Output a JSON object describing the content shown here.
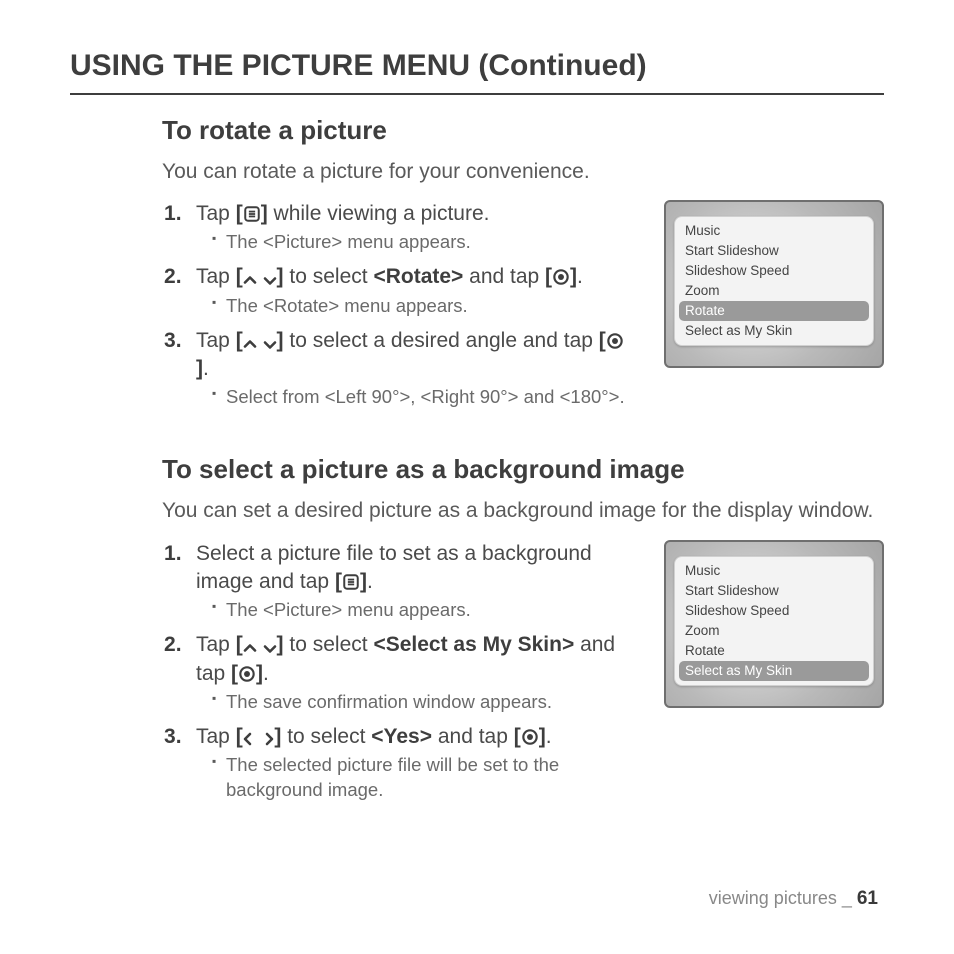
{
  "page_title": "USING THE PICTURE MENU (Continued)",
  "sections": {
    "rotate": {
      "heading": "To rotate a picture",
      "intro": "You can rotate a picture for your convenience.",
      "steps": [
        {
          "pre": "Tap ",
          "icon": "menu",
          "post": " while viewing a picture.",
          "sub": [
            "The <Picture> menu appears."
          ]
        },
        {
          "pre": "Tap ",
          "icon": "updown",
          "mid": " to select ",
          "bold": "<Rotate>",
          "mid2": " and tap ",
          "icon2": "target",
          "post": ".",
          "sub": [
            "The <Rotate> menu appears."
          ]
        },
        {
          "pre": "Tap ",
          "icon": "updown",
          "mid": " to select a desired angle and tap ",
          "icon2": "target",
          "post": ".",
          "sub": [
            "Select from <Left 90°>, <Right 90°> and <180°>."
          ]
        }
      ],
      "menu_selected": "Rotate"
    },
    "skin": {
      "heading": "To select a picture as a background image",
      "intro": "You can set a desired picture as a background image for the display window.",
      "steps": [
        {
          "pre": "Select a picture file to set as a background image and tap ",
          "icon": "menu",
          "post": ".",
          "sub": [
            "The <Picture> menu appears."
          ]
        },
        {
          "pre": "Tap ",
          "icon": "updown",
          "mid": " to select ",
          "bold": "<Select as My Skin>",
          "mid2": " and tap ",
          "icon2": "target",
          "post": ".",
          "sub": [
            "The save confirmation window appears."
          ]
        },
        {
          "pre": "Tap ",
          "icon": "leftright",
          "mid": " to select ",
          "bold": "<Yes>",
          "mid2": " and tap ",
          "icon2": "target",
          "post": ".",
          "sub": [
            "The selected picture file will be set to the background image."
          ]
        }
      ],
      "menu_selected": "Select as My Skin"
    }
  },
  "menu_items": [
    "Music",
    "Start Slideshow",
    "Slideshow Speed",
    "Zoom",
    "Rotate",
    "Select as My Skin"
  ],
  "footer": {
    "label": "viewing pictures _ ",
    "page": "61"
  }
}
